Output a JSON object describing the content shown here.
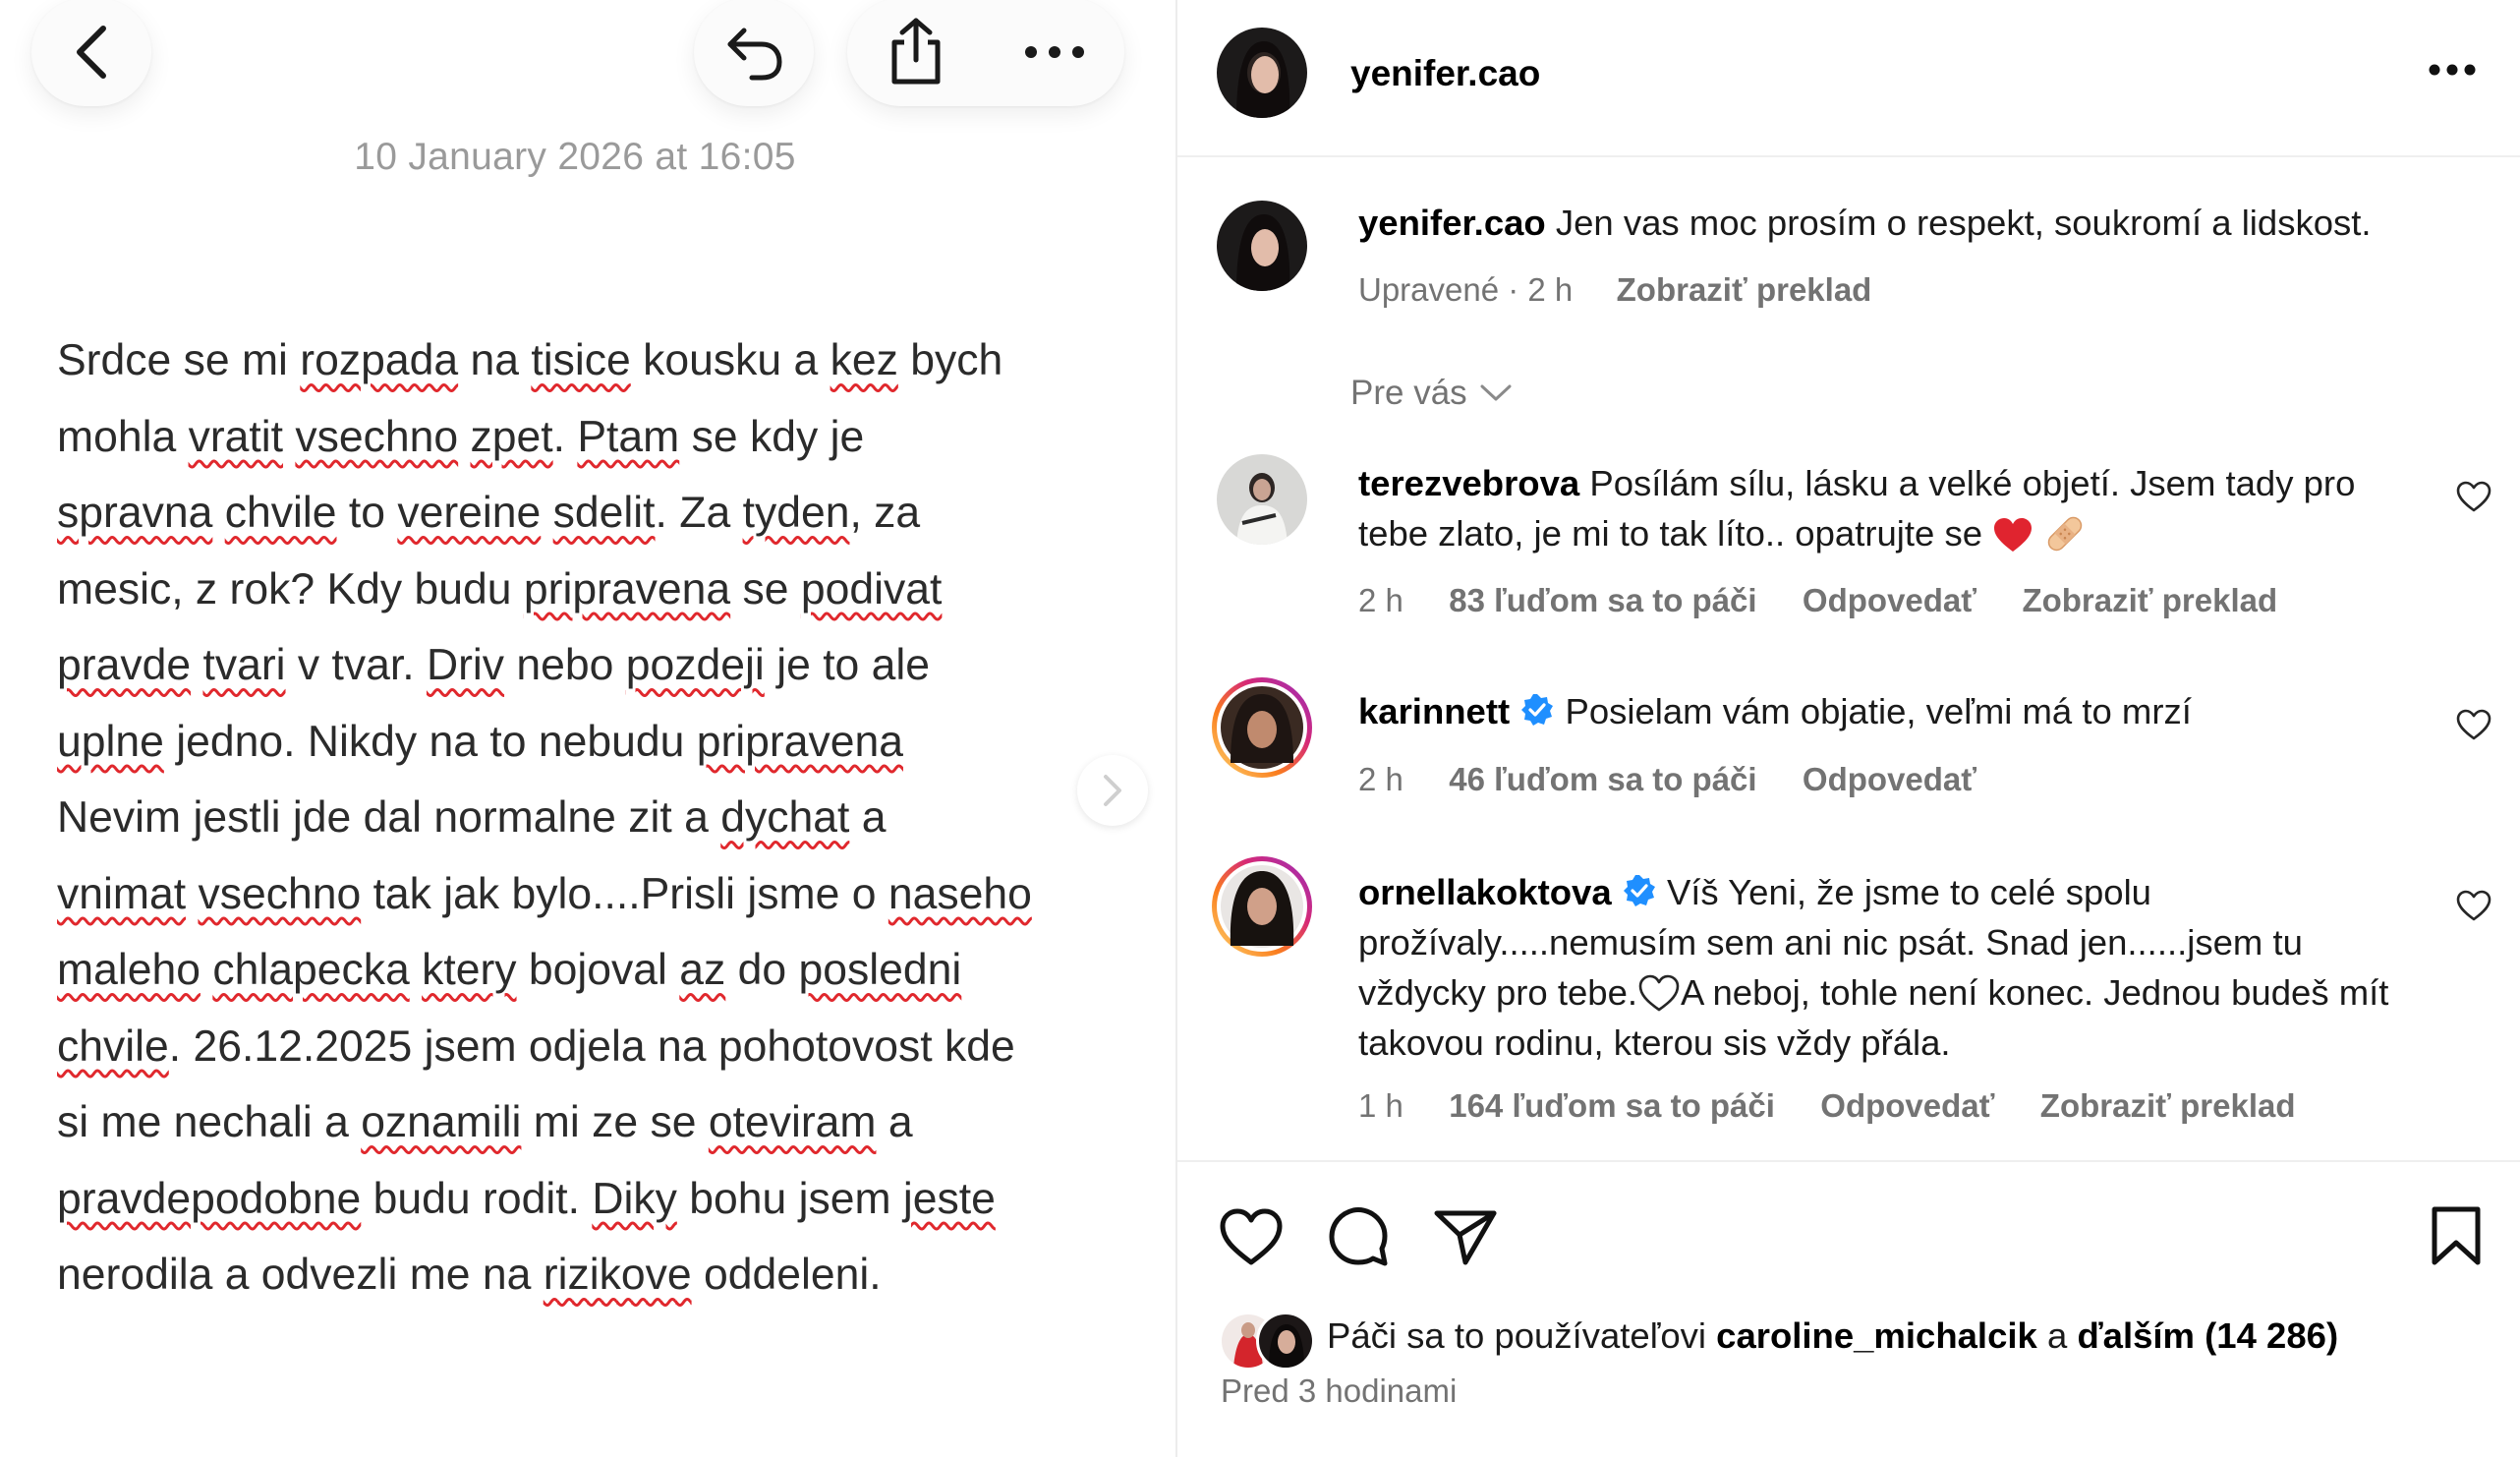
{
  "note": {
    "date": "10 January 2026 at 16:05",
    "lines": [
      [
        {
          "t": "Srdce se mi "
        },
        {
          "t": "rozpada",
          "s": 1
        },
        {
          "t": " na "
        },
        {
          "t": "tisice",
          "s": 1
        },
        {
          "t": " kousku a "
        },
        {
          "t": "kez",
          "s": 1
        },
        {
          "t": " bych"
        }
      ],
      [
        {
          "t": "mohla "
        },
        {
          "t": "vratit",
          "s": 1
        },
        {
          "t": " "
        },
        {
          "t": "vsechno",
          "s": 1
        },
        {
          "t": " "
        },
        {
          "t": "zpet",
          "s": 1
        },
        {
          "t": ". "
        },
        {
          "t": "Ptam",
          "s": 1
        },
        {
          "t": " se kdy je"
        }
      ],
      [
        {
          "t": "spravna",
          "s": 1
        },
        {
          "t": " "
        },
        {
          "t": "chvile",
          "s": 1
        },
        {
          "t": " to "
        },
        {
          "t": "vereine",
          "s": 1
        },
        {
          "t": " "
        },
        {
          "t": "sdelit",
          "s": 1
        },
        {
          "t": ". Za "
        },
        {
          "t": "tyden",
          "s": 1
        },
        {
          "t": ", za"
        }
      ],
      [
        {
          "t": "mesic, z rok? Kdy budu "
        },
        {
          "t": "pripravena",
          "s": 1
        },
        {
          "t": " se "
        },
        {
          "t": "podivat",
          "s": 1
        }
      ],
      [
        {
          "t": "pravde",
          "s": 1
        },
        {
          "t": " "
        },
        {
          "t": "tvari",
          "s": 1
        },
        {
          "t": " v tvar. "
        },
        {
          "t": "Driv",
          "s": 1
        },
        {
          "t": " nebo "
        },
        {
          "t": "pozdeji",
          "s": 1
        },
        {
          "t": " je to ale"
        }
      ],
      [
        {
          "t": "uplne",
          "s": 1
        },
        {
          "t": " jedno. Nikdy na to nebudu "
        },
        {
          "t": "pripravena",
          "s": 1
        }
      ],
      [
        {
          "t": "Nevim jestli jde dal normalne zit a "
        },
        {
          "t": "dychat",
          "s": 1
        },
        {
          "t": " a"
        }
      ],
      [
        {
          "t": "vnimat",
          "s": 1
        },
        {
          "t": " "
        },
        {
          "t": "vsechno",
          "s": 1
        },
        {
          "t": " tak jak bylo....Prisli jsme o "
        },
        {
          "t": "naseho",
          "s": 1
        }
      ],
      [
        {
          "t": "maleho",
          "s": 1
        },
        {
          "t": " "
        },
        {
          "t": "chlapecka",
          "s": 1
        },
        {
          "t": " "
        },
        {
          "t": "ktery",
          "s": 1
        },
        {
          "t": " bojoval "
        },
        {
          "t": "az",
          "s": 1
        },
        {
          "t": " do "
        },
        {
          "t": "posledni",
          "s": 1
        }
      ],
      [
        {
          "t": "chvile",
          "s": 1
        },
        {
          "t": ". 26.12.2025 jsem odjela na pohotovost kde"
        }
      ],
      [
        {
          "t": "si me nechali a "
        },
        {
          "t": "oznamili",
          "s": 1
        },
        {
          "t": " mi ze se "
        },
        {
          "t": "oteviram",
          "s": 1
        },
        {
          "t": " a"
        }
      ],
      [
        {
          "t": "pravdepodobne",
          "s": 1
        },
        {
          "t": " budu rodit. "
        },
        {
          "t": "Diky",
          "s": 1
        },
        {
          "t": " bohu jsem "
        },
        {
          "t": "jeste",
          "s": 1
        }
      ],
      [
        {
          "t": "nerodila a odvezli me na "
        },
        {
          "t": "rizikove",
          "s": 1
        },
        {
          "t": " oddeleni."
        }
      ]
    ]
  },
  "post": {
    "author": "yenifer.cao",
    "caption_user": "yenifer.cao",
    "caption_text": "Jen vas moc prosím o respekt, soukromí a lidskost.",
    "caption_meta": "Upravené · 2 h",
    "caption_translate": "Zobraziť preklad",
    "filter_label": "Pre vás",
    "comments": [
      {
        "user": "terezvebrova",
        "verified": false,
        "text": "Posílám sílu, lásku a velké objetí. Jsem tady pro tebe zlato, je mi to tak líto.. opatrujte se",
        "emoji": [
          "red-heart",
          "bandage"
        ],
        "time": "2 h",
        "likes": "83 ľuďom sa to páči",
        "reply": "Odpovedať",
        "translate": "Zobraziť preklad"
      },
      {
        "user": "karinnett",
        "verified": true,
        "text": "Posielam vám objatie, veľmi má to mrzí",
        "time": "2 h",
        "likes": "46 ľuďom sa to páči",
        "reply": "Odpovedať",
        "translate": ""
      },
      {
        "user": "ornellakoktova",
        "verified": true,
        "text_before_heart": "Víš Yeni, že jsme to celé spolu prožívaly.....nemusím sem ani nic psát. Snad jen......jsem tu vždycky pro tebe.",
        "text_after_heart": "A neboj, tohle není konec. Jednou budeš mít takovou rodinu, kterou sis vždy přála.",
        "time": "1 h",
        "likes": "164 ľuďom sa to páči",
        "reply": "Odpovedať",
        "translate": "Zobraziť preklad"
      }
    ],
    "likes_prefix": "Páči sa to používateľovi",
    "likes_user": "caroline_michalcik",
    "likes_and": "a",
    "likes_others": "ďalším (14 286)",
    "posted": "Pred 3 hodinami",
    "icons": [
      "like-icon",
      "comment-icon",
      "share-icon",
      "save-icon",
      "more-icon"
    ]
  }
}
